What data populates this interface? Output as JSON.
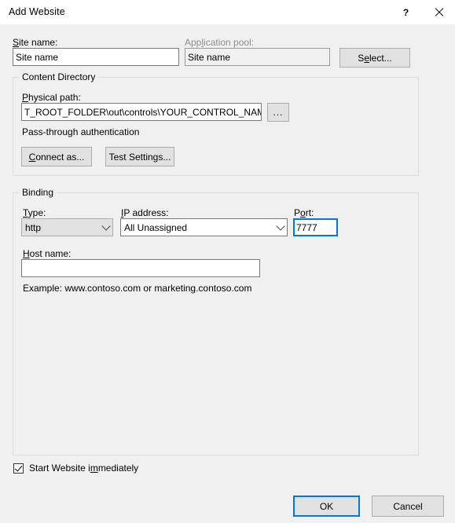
{
  "window": {
    "title": "Add Website",
    "help_icon": "question-mark-icon",
    "close_icon": "close-icon"
  },
  "site_name": {
    "label_pre": "S",
    "label_post": "ite name:",
    "value": "Site name"
  },
  "app_pool": {
    "label_pre": "App",
    "label_mid": "l",
    "label_post": "ication pool:",
    "value": "Site name",
    "select_button_pre": "S",
    "select_button_mid": "e",
    "select_button_post": "lect..."
  },
  "content_directory": {
    "group_title": "Content Directory",
    "physical_path_label_pre": "P",
    "physical_path_label_post": "hysical path:",
    "physical_path_value": "T_ROOT_FOLDER\\out\\controls\\YOUR_CONTROL_NAME\\",
    "browse_button": "...",
    "passthrough_text": "Pass-through authentication",
    "connect_as_pre": "C",
    "connect_as_post": "onnect as...",
    "test_settings_pre": "Test Settin",
    "test_settings_mid": "g",
    "test_settings_post": "s..."
  },
  "binding": {
    "group_title": "Binding",
    "type_label_pre": "T",
    "type_label_post": "ype:",
    "type_value": "http",
    "ip_label_pre": "I",
    "ip_label_post": "P address:",
    "ip_value": "All Unassigned",
    "port_label_pre": "P",
    "port_label_mid": "o",
    "port_label_post": "rt:",
    "port_value": "7777",
    "host_label_pre": "H",
    "host_label_post": "ost name:",
    "host_value": "",
    "example_text": "Example: www.contoso.com or marketing.contoso.com"
  },
  "footer": {
    "start_checkbox_checked": true,
    "start_label_pre": "Start Website i",
    "start_label_mid": "m",
    "start_label_post": "mediately",
    "ok_button": "OK",
    "cancel_button": "Cancel"
  },
  "colors": {
    "accent": "#0078d7",
    "dialog_bg": "#f0f0f0",
    "titlebar_bg": "#ffffff",
    "button_bg": "#e1e1e1",
    "disabled_text": "#8d8d8d"
  }
}
